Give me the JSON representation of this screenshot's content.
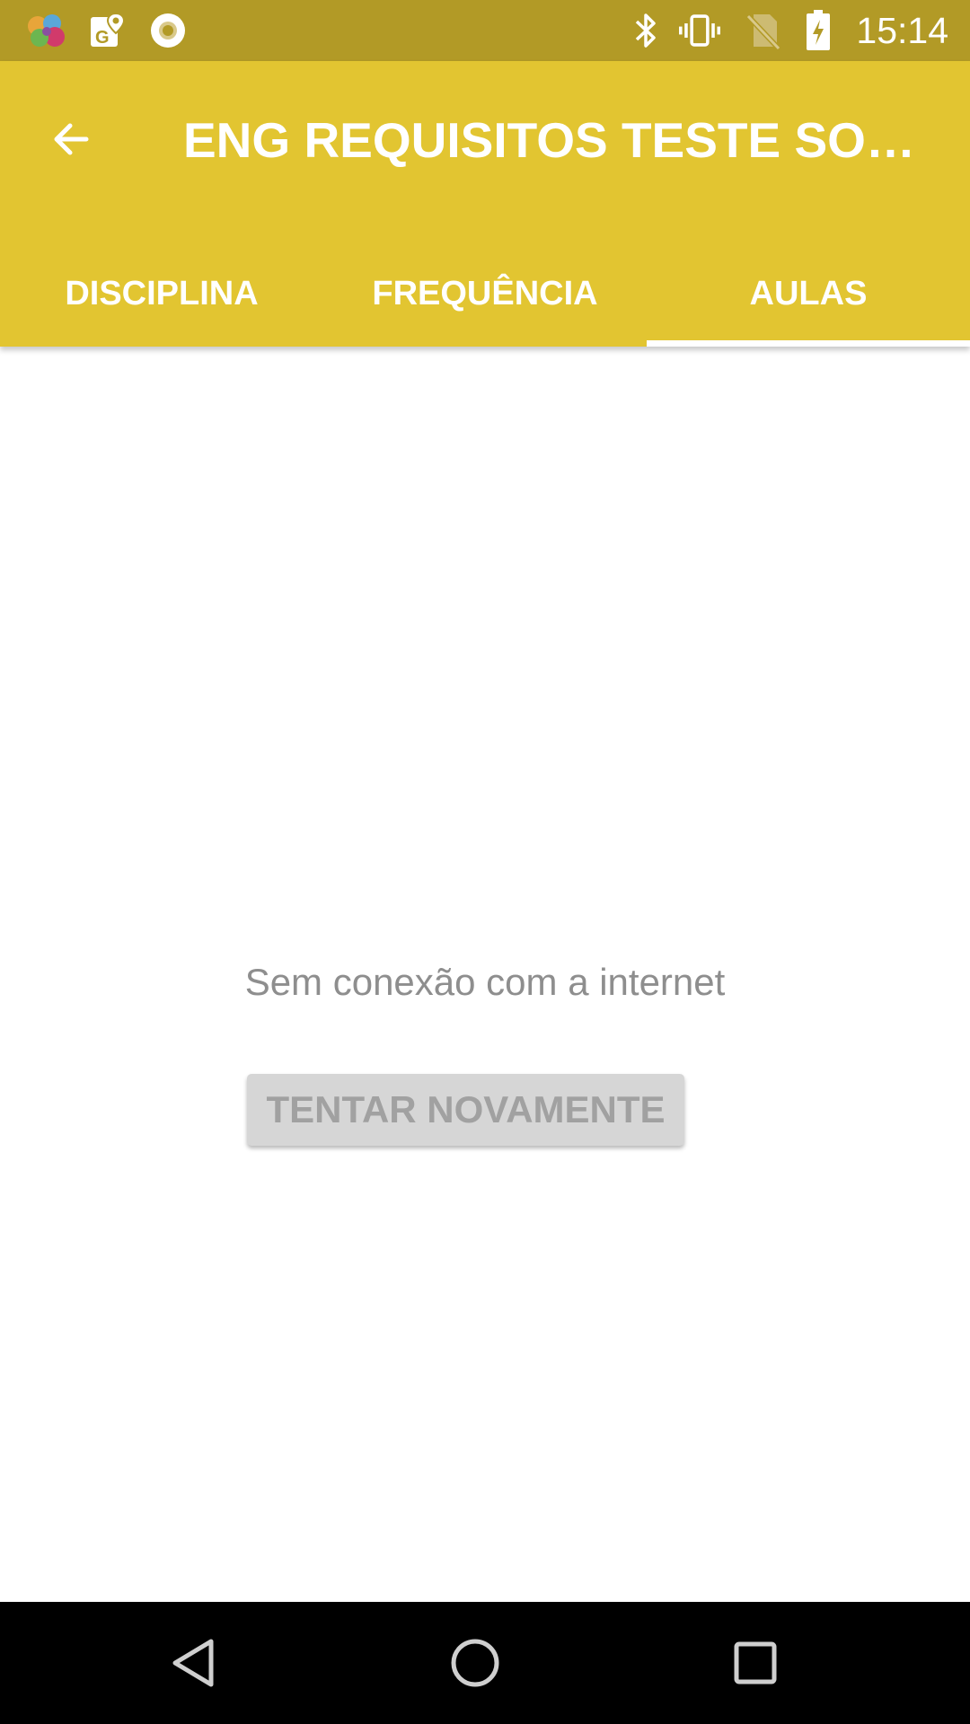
{
  "status_bar": {
    "time": "15:14",
    "left_icons": [
      "colorful-app-icon",
      "maps-g-icon",
      "record-circle-icon"
    ],
    "right_icons": [
      "bluetooth-icon",
      "vibrate-icon",
      "no-sim-icon",
      "battery-charging-icon"
    ]
  },
  "app_bar": {
    "title": "ENG REQUISITOS TESTE SOFTWARE",
    "back_icon": "arrow-back-icon",
    "color": "#e2c531"
  },
  "tabs": [
    {
      "label": "DISCIPLINA",
      "selected": false
    },
    {
      "label": "FREQUÊNCIA",
      "selected": false
    },
    {
      "label": "AULAS",
      "selected": true
    }
  ],
  "content": {
    "message": "Sem conexão com a internet",
    "retry_label": "TENTAR NOVAMENTE"
  },
  "nav_bar": {
    "icons": [
      "back-triangle-icon",
      "home-circle-icon",
      "recents-square-icon"
    ]
  }
}
